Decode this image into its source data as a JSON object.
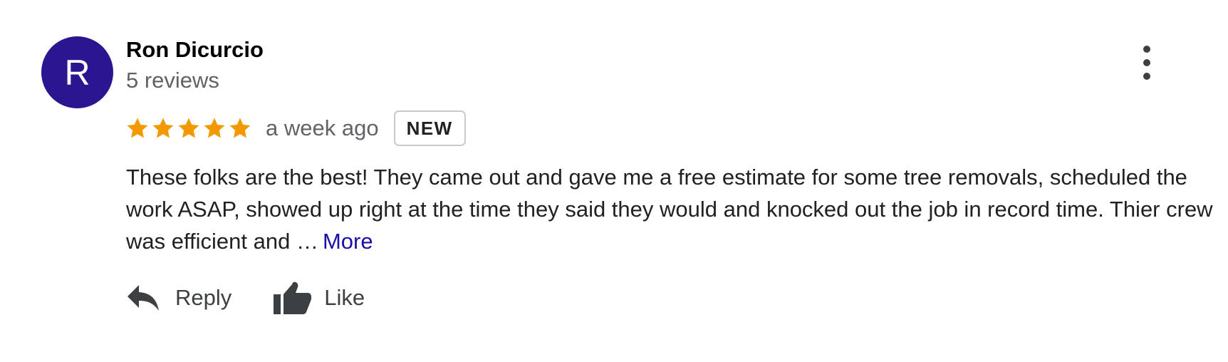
{
  "review": {
    "author": {
      "initial": "R",
      "name": "Ron Dicurcio",
      "review_count": "5 reviews",
      "avatar_color": "#2b1591"
    },
    "rating": 5,
    "rating_max": 5,
    "star_color": "#f29900",
    "time_ago": "a week ago",
    "badge": "NEW",
    "text": "These folks are the best! They came out and gave me a free estimate for some tree removals, scheduled the work ASAP, showed up right at the time they said they would and knocked out the job in record time. Thier crew was efficient and …",
    "more_label": "More",
    "more_link_color": "#1a0dab",
    "actions": {
      "reply_label": "Reply",
      "reply_icon": "reply-icon",
      "like_label": "Like",
      "like_icon": "thumbs-up-icon"
    },
    "menu_icon": "more-vert-icon"
  }
}
